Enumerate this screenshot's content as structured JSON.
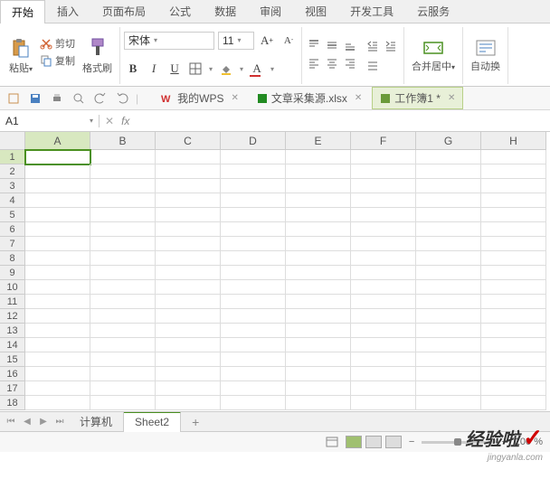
{
  "tabs": [
    "开始",
    "插入",
    "页面布局",
    "公式",
    "数据",
    "审阅",
    "视图",
    "开发工具",
    "云服务"
  ],
  "active_tab": 0,
  "ribbon": {
    "paste": "粘贴",
    "cut": "剪切",
    "copy": "复制",
    "format_painter": "格式刷",
    "font_name": "宋体",
    "font_size": "11",
    "merge_center": "合并居中",
    "auto_wrap": "自动换"
  },
  "qat": {
    "wps_label": "我的WPS",
    "docs": [
      {
        "name": "文章采集源.xlsx",
        "active": false,
        "icon_color": "#228b22"
      },
      {
        "name": "工作簿1 *",
        "active": true,
        "icon_color": "#6a9a3a"
      }
    ]
  },
  "namebox": "A1",
  "fx": "fx",
  "columns": [
    "A",
    "B",
    "C",
    "D",
    "E",
    "F",
    "G",
    "H"
  ],
  "rows": [
    "1",
    "2",
    "3",
    "4",
    "5",
    "6",
    "7",
    "8",
    "9",
    "10",
    "11",
    "12",
    "13",
    "14",
    "15",
    "16",
    "17",
    "18"
  ],
  "selected_cell": {
    "row": 0,
    "col": 0
  },
  "sheets": [
    "计算机",
    "Sheet2"
  ],
  "active_sheet": 1,
  "zoom": "100 %",
  "watermark": {
    "title": "经验啦",
    "sub": "jingyanla.com"
  }
}
